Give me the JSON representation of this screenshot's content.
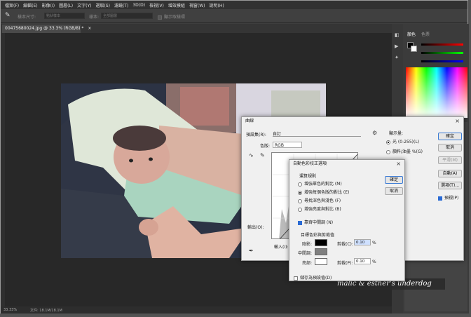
{
  "menubar": {
    "items": [
      "檔案(F)",
      "編輯(E)",
      "影像(I)",
      "圖層(L)",
      "文字(Y)",
      "選取(S)",
      "濾鏡(T)",
      "3D(D)",
      "檢視(V)",
      "增效模組",
      "視窗(W)",
      "說明(H)"
    ]
  },
  "optbar": {
    "size_label": "樣本尺寸:",
    "size_value": "點狀樣本",
    "sample_label": "樣本:",
    "sample_value": "全部圖層",
    "show_ring": "顯示取樣環"
  },
  "document": {
    "tab_title": "00475680024.jpg @ 33.3% (RGB/8) *",
    "zoom": "33.33%",
    "doc_info": "文件: 18.1M/18.1M"
  },
  "right_panel": {
    "tab_color": "顏色",
    "tab_swatches": "色票"
  },
  "curves": {
    "title": "曲線",
    "preset_label": "預設集(R):",
    "preset_value": "自訂",
    "channel_label": "色版:",
    "channel_value": "RGB",
    "output_label": "輸出(O):",
    "input_label": "輸入(I):",
    "display_label": "顯示量:",
    "opt_light": "光 (0-255)(L)",
    "opt_pigment": "顏料/油墨 %(G)",
    "ok": "確定",
    "cancel": "取消",
    "smooth": "平滑(M)",
    "auto": "自動(A)",
    "options": "選項(T)...",
    "preview": "預視(P)"
  },
  "auto_color": {
    "title": "自動色彩校正選項",
    "algorithms_label": "運算規則",
    "algo1": "增強單色的對比 (M)",
    "algo2": "增強每個色版的對比 (E)",
    "algo3": "尋找深色與淺色 (F)",
    "algo4": "增強亮度與對比 (B)",
    "snap": "靠齊中間調 (N)",
    "targets_label": "目標色彩與剪裁值",
    "shadows": "陰影:",
    "midtones": "中間調:",
    "highlights": "亮部:",
    "clip1_label": "剪裁(C):",
    "clip1_value": "0.10",
    "clip2_label": "剪裁(P):",
    "clip2_value": "0.10",
    "pct": "%",
    "save_default": "儲存為預設值(D)",
    "ok": "確定",
    "cancel": "取消"
  },
  "watermark": {
    "text": "malic & esther's underdog"
  }
}
